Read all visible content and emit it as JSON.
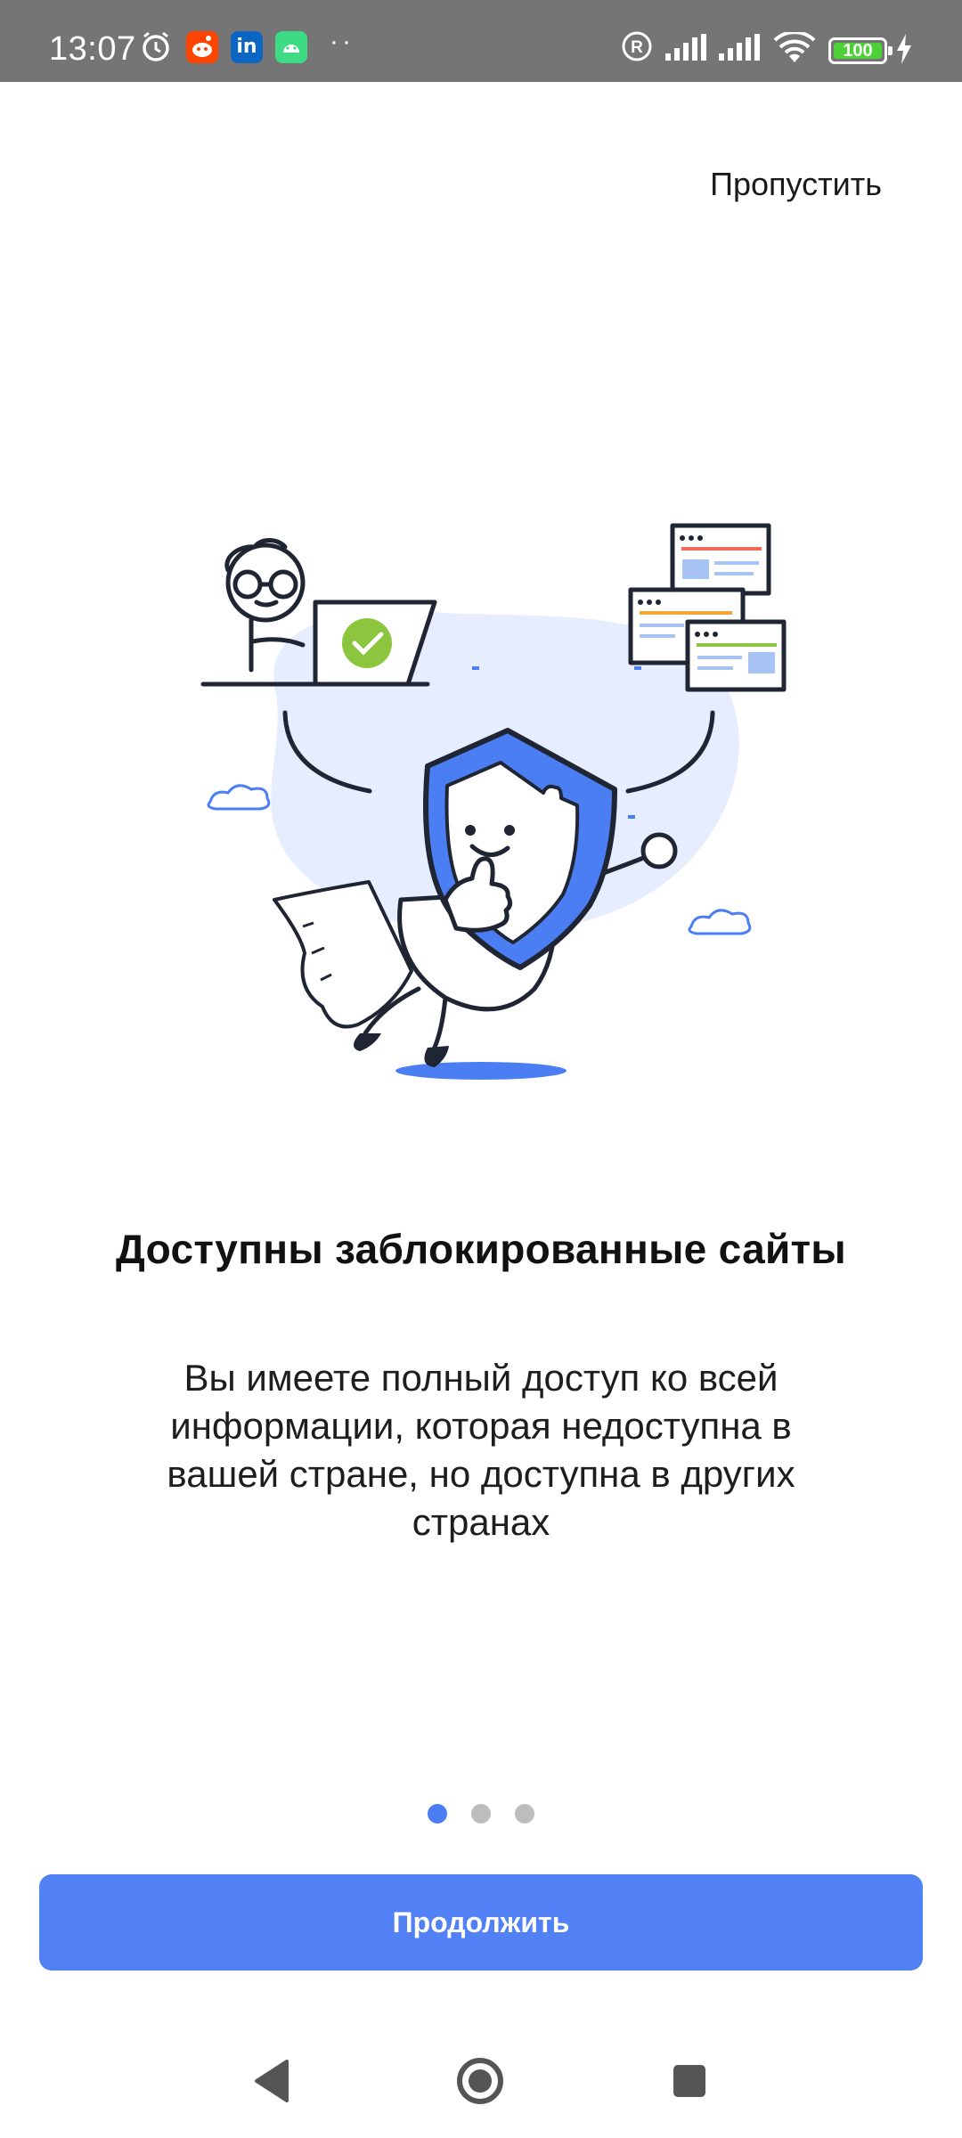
{
  "status_bar": {
    "time": "13:07",
    "battery": "100",
    "battery_level": 1.0,
    "icons": [
      "alarm-icon",
      "reddit-icon",
      "linkedin-icon",
      "android-app-icon",
      "more-dots-icon",
      "registered-icon",
      "signal-icon",
      "signal-icon",
      "wifi-icon",
      "battery-icon",
      "charging-icon"
    ]
  },
  "onboarding": {
    "skip_label": "Пропустить",
    "title": "Доступны заблокированные сайты",
    "description": "Вы имеете полный доступ ко всей информации, которая недоступна в вашей стране, но доступна в других странах",
    "page_count": 3,
    "current_page": 1,
    "continue_label": "Продолжить"
  },
  "colors": {
    "accent": "#5181f4",
    "dot_active": "#4c7ef3",
    "dot_inactive": "#bdbdbd",
    "status_bar": "#757575",
    "illustration_bg": "#e6edff"
  },
  "nav_bar": {
    "icons": [
      "back-icon",
      "home-icon",
      "recents-icon"
    ]
  }
}
